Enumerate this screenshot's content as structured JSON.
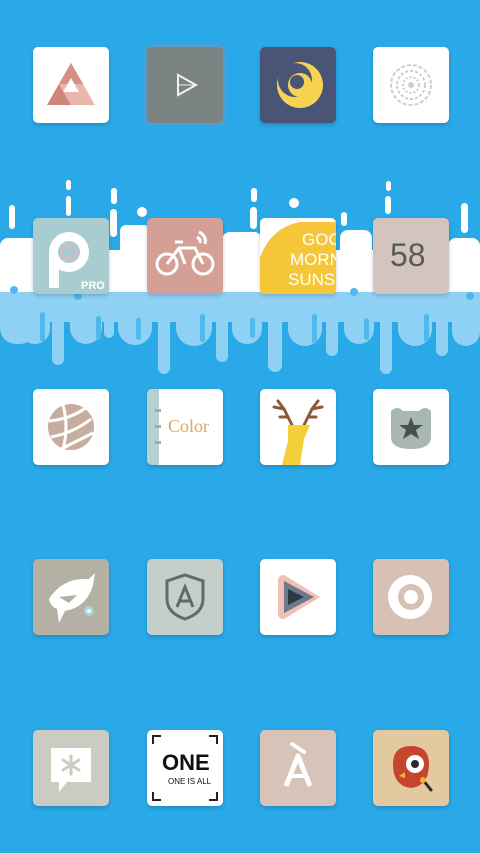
{
  "home_screen": {
    "icons": [
      {
        "row": 1,
        "col": 1,
        "icon": "origami-triangle-icon",
        "bg": "#ffffff"
      },
      {
        "row": 1,
        "col": 2,
        "icon": "play-triangle-icon",
        "bg": "#7b8383"
      },
      {
        "row": 1,
        "col": 3,
        "icon": "crescent-moon-icon",
        "bg": "#4a5476"
      },
      {
        "row": 1,
        "col": 4,
        "icon": "mandala-flower-icon",
        "bg": "#ffffff"
      },
      {
        "row": 2,
        "col": 1,
        "icon": "picsart-p-icon",
        "bg": "#a8ccd0",
        "label": "PRO"
      },
      {
        "row": 2,
        "col": 2,
        "icon": "bicycle-icon",
        "bg": "#d4a096"
      },
      {
        "row": 2,
        "col": 3,
        "icon": "good-morning-sunshine-icon",
        "bg": "#ffffff",
        "lines": [
          "GOO",
          "MORNI",
          "SUNSH"
        ]
      },
      {
        "row": 2,
        "col": 4,
        "icon": "number-58-icon",
        "bg": "#d3c5bd",
        "label": "58"
      },
      {
        "row": 3,
        "col": 1,
        "icon": "volleyball-icon",
        "bg": "#ffffff"
      },
      {
        "row": 3,
        "col": 2,
        "icon": "color-notebook-icon",
        "bg": "#ffffff",
        "label": "Color"
      },
      {
        "row": 3,
        "col": 3,
        "icon": "deer-head-icon",
        "bg": "#ffffff"
      },
      {
        "row": 3,
        "col": 4,
        "icon": "star-badge-icon",
        "bg": "#ffffff"
      },
      {
        "row": 4,
        "col": 1,
        "icon": "shark-icon",
        "bg": "#b4b0a3"
      },
      {
        "row": 4,
        "col": 2,
        "icon": "shield-a-icon",
        "bg": "#c4cfcc"
      },
      {
        "row": 4,
        "col": 3,
        "icon": "video-play-icon",
        "bg": "#ffffff"
      },
      {
        "row": 4,
        "col": 4,
        "icon": "webcam-eye-icon",
        "bg": "#d7c1b4"
      },
      {
        "row": 5,
        "col": 1,
        "icon": "asterisk-chat-icon",
        "bg": "#cbcbc2"
      },
      {
        "row": 5,
        "col": 2,
        "icon": "one-is-all-icon",
        "bg": "#ffffff",
        "label": "ONE",
        "sublabel": "ONE IS ALL"
      },
      {
        "row": 5,
        "col": 3,
        "icon": "letter-a-icon",
        "bg": "#d8c3b8"
      },
      {
        "row": 5,
        "col": 4,
        "icon": "owl-bird-icon",
        "bg": "#e3c9a0"
      }
    ]
  }
}
